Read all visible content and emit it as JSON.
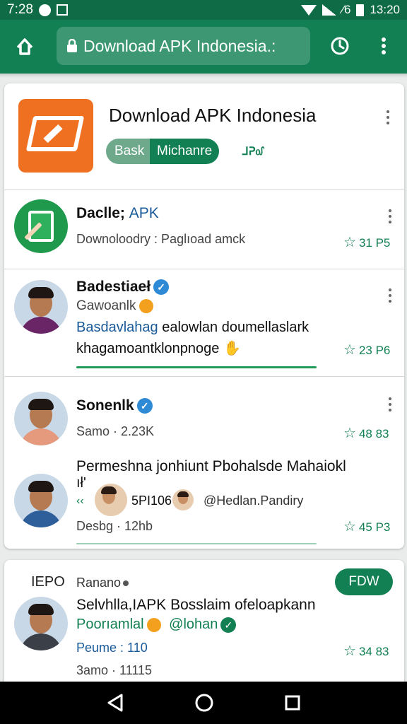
{
  "status_bar": {
    "time": "7:28",
    "right_label": "⁄6",
    "clock_right": "13:20"
  },
  "browser": {
    "url": "Download APK Indonesia.:"
  },
  "header": {
    "title": "Download APK Indonesia",
    "segment_left": "Bask",
    "segment_right": "Michanre",
    "extra": "ᒧᕈ᧞"
  },
  "items": [
    {
      "name_a": "Daclle;",
      "name_b": "APK",
      "sub": "Downoloodry : Paglıoad amck",
      "rating": "31 P5"
    },
    {
      "name": "Badestiaeł",
      "sub": "Gawoanlk",
      "line1_blue": "Basdavlahag",
      "line1_rest": "ealowlan doumellaslark",
      "line2": "khagamoantklonpnoge",
      "rating": "23 P6"
    },
    {
      "name": "Sonenlk",
      "sub": "Samo · 2.23K",
      "rating": "48 83"
    },
    {
      "headline_1": "Permeshna jonhiunt Pbohalsde Mahaiokl",
      "headline_2": "ıł'",
      "mini_1": "5PI106",
      "mini_2": "@Hedlan.Pandiry",
      "sub": "Desbg · 12hb",
      "rating": "45 P3"
    }
  ],
  "post": {
    "tag": "IEPO",
    "author": "Ranano",
    "follow": "FDW",
    "title": "Selvhlla,IAPK Bosslaim ofeloapkann",
    "line_green": "Poorıamlal",
    "handle": "@lohan",
    "meta_blue": "Peume : 110",
    "meta_gray": "3amo · 11115",
    "rating": "34 83"
  },
  "colors": {
    "brand": "#128053",
    "status_bar": "#0f6b45",
    "app_icon": "#f07022",
    "link_blue": "#1b5a99"
  }
}
